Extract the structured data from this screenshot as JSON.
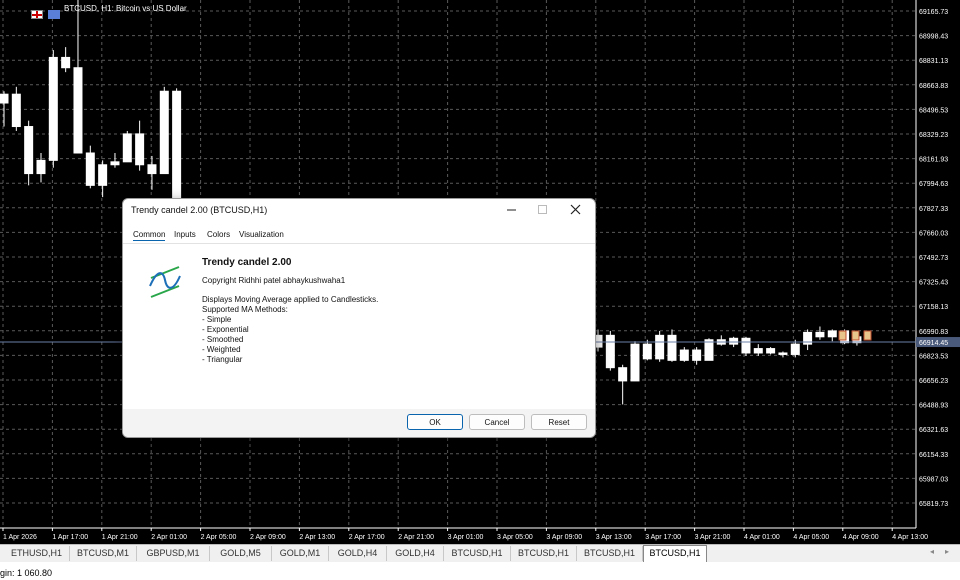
{
  "chart": {
    "title": "BTCUSD, H1:  Bitcoin vs US Dollar",
    "current_price": "66914.45",
    "price_axis": [
      "69165.73",
      "68998.43",
      "68831.13",
      "68663.83",
      "68496.53",
      "68329.23",
      "68161.93",
      "67994.63",
      "67827.33",
      "67660.03",
      "67492.73",
      "67325.43",
      "67158.13",
      "66990.83",
      "66823.53",
      "66656.23",
      "66488.93",
      "66321.63",
      "66154.33",
      "65987.03",
      "65819.73"
    ],
    "time_axis": [
      "1 Apr 2026",
      "1 Apr 17:00",
      "1 Apr 21:00",
      "2 Apr 01:00",
      "2 Apr 05:00",
      "2 Apr 09:00",
      "2 Apr 13:00",
      "2 Apr 17:00",
      "2 Apr 21:00",
      "3 Apr 01:00",
      "3 Apr 05:00",
      "3 Apr 09:00",
      "3 Apr 13:00",
      "3 Apr 17:00",
      "3 Apr 21:00",
      "4 Apr 01:00",
      "4 Apr 05:00",
      "4 Apr 09:00",
      "4 Apr 13:00"
    ],
    "colors": {
      "background": "#000000",
      "grid": "#5a5a5a",
      "bull_body": "#ffffff",
      "bear_body": "#ffffff",
      "text": "#ffffff",
      "price_tag": "#4a5a7a"
    }
  },
  "chart_data": {
    "type": "candlestick",
    "title": "BTCUSD, H1:  Bitcoin vs US Dollar",
    "ylim": [
      65740,
      69200
    ],
    "candles_before_dialog": [
      [
        68540,
        68620,
        68380,
        68600
      ],
      [
        68600,
        68650,
        68350,
        68380
      ],
      [
        68380,
        68420,
        67980,
        68060
      ],
      [
        68060,
        68200,
        68000,
        68150
      ],
      [
        68150,
        68900,
        68100,
        68850
      ],
      [
        68850,
        68920,
        68750,
        68780
      ],
      [
        68780,
        69280,
        68200,
        68200
      ],
      [
        68200,
        68250,
        67960,
        67980
      ],
      [
        67980,
        68150,
        67900,
        68120
      ],
      [
        68120,
        68200,
        68100,
        68140
      ],
      [
        68140,
        68350,
        68140,
        68330
      ],
      [
        68330,
        68420,
        68080,
        68120
      ],
      [
        68120,
        68180,
        67950,
        68060
      ],
      [
        68060,
        68650,
        68060,
        68620
      ],
      [
        68620,
        68640,
        67800,
        67820
      ]
    ],
    "candles_after_dialog": [
      [
        66880,
        67000,
        66850,
        66960
      ],
      [
        66960,
        66990,
        66720,
        66740
      ],
      [
        66740,
        66760,
        66490,
        66650
      ],
      [
        66650,
        66920,
        66650,
        66900
      ],
      [
        66900,
        66930,
        66790,
        66800
      ],
      [
        66800,
        66990,
        66780,
        66960
      ],
      [
        66960,
        67000,
        66780,
        66790
      ],
      [
        66790,
        66880,
        66780,
        66860
      ],
      [
        66860,
        66880,
        66760,
        66790
      ],
      [
        66790,
        66940,
        66790,
        66930
      ],
      [
        66930,
        66960,
        66890,
        66900
      ],
      [
        66900,
        66950,
        66880,
        66940
      ],
      [
        66940,
        66950,
        66820,
        66840
      ],
      [
        66840,
        66900,
        66820,
        66870
      ],
      [
        66870,
        66880,
        66830,
        66840
      ],
      [
        66840,
        66850,
        66810,
        66830
      ],
      [
        66830,
        66930,
        66810,
        66900
      ],
      [
        66900,
        67000,
        66860,
        66980
      ],
      [
        66980,
        67020,
        66930,
        66950
      ],
      [
        66950,
        67000,
        66920,
        66990
      ],
      [
        66990,
        67000,
        66900,
        66910
      ],
      [
        66910,
        66960,
        66890,
        66950
      ]
    ]
  },
  "tabs": [
    "ETHUSD,H1",
    "BTCUSD,M1",
    "GBPUSD,M1",
    "GOLD,M5",
    "GOLD,M1",
    "GOLD,H4",
    "GOLD,H4",
    "BTCUSD,H1",
    "BTCUSD,H1",
    "BTCUSD,H1",
    "BTCUSD,H1"
  ],
  "active_tab_index": 10,
  "status": {
    "margin": "gin: 1 060.80"
  },
  "dialog": {
    "title": "Trendy candel 2.00 (BTCUSD,H1)",
    "tabs": [
      "Common",
      "Inputs",
      "Colors",
      "Visualization"
    ],
    "active_tab": "Common",
    "indicator_name": "Trendy candel 2.00",
    "copyright": "Copyright Ridhhi patel  abhaykushwaha1",
    "description": [
      "Displays Moving Average applied to Candlesticks.",
      "Supported MA Methods:",
      "- Simple",
      "- Exponential",
      "- Smoothed",
      "- Weighted",
      "- Triangular"
    ],
    "buttons": {
      "ok": "OK",
      "cancel": "Cancel",
      "reset": "Reset"
    }
  }
}
